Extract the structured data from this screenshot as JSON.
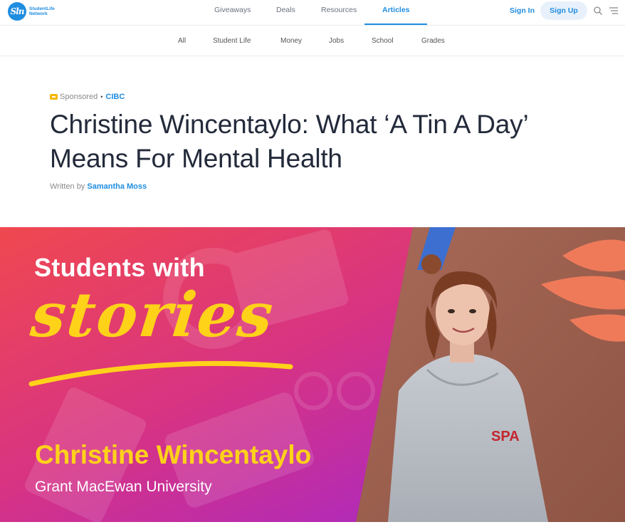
{
  "brand": {
    "logo_mark": "Sln",
    "logo_name_line1": "StudentLife",
    "logo_name_line2": "Network"
  },
  "nav": {
    "items": [
      {
        "label": "Giveaways",
        "active": false
      },
      {
        "label": "Deals",
        "active": false
      },
      {
        "label": "Resources",
        "active": false
      },
      {
        "label": "Articles",
        "active": true
      }
    ],
    "sign_in": "Sign In",
    "sign_up": "Sign Up",
    "icons": [
      "search-icon",
      "menu-icon"
    ]
  },
  "subnav": {
    "items": [
      "All",
      "Student Life",
      "Money",
      "Jobs",
      "School",
      "Grades"
    ]
  },
  "article": {
    "sponsored_label": "Sponsored",
    "sponsor": "CIBC",
    "title": "Christine Wincentaylo: What ‘A Tin A Day’ Means For Mental Health",
    "written_by": "Written by",
    "author": "Samantha Moss"
  },
  "hero": {
    "heading": "Students with",
    "script": "stories",
    "name": "Christine Wincentaylo",
    "school": "Grant MacEwan University",
    "colors": {
      "gradient_start": "#f0484f",
      "gradient_mid": "#d73384",
      "gradient_end": "#9b25d6",
      "accent_yellow": "#ffd21a",
      "wall": "#9c5f4e"
    }
  },
  "colors": {
    "accent": "#1f8de0",
    "title_text": "#232a3a"
  }
}
